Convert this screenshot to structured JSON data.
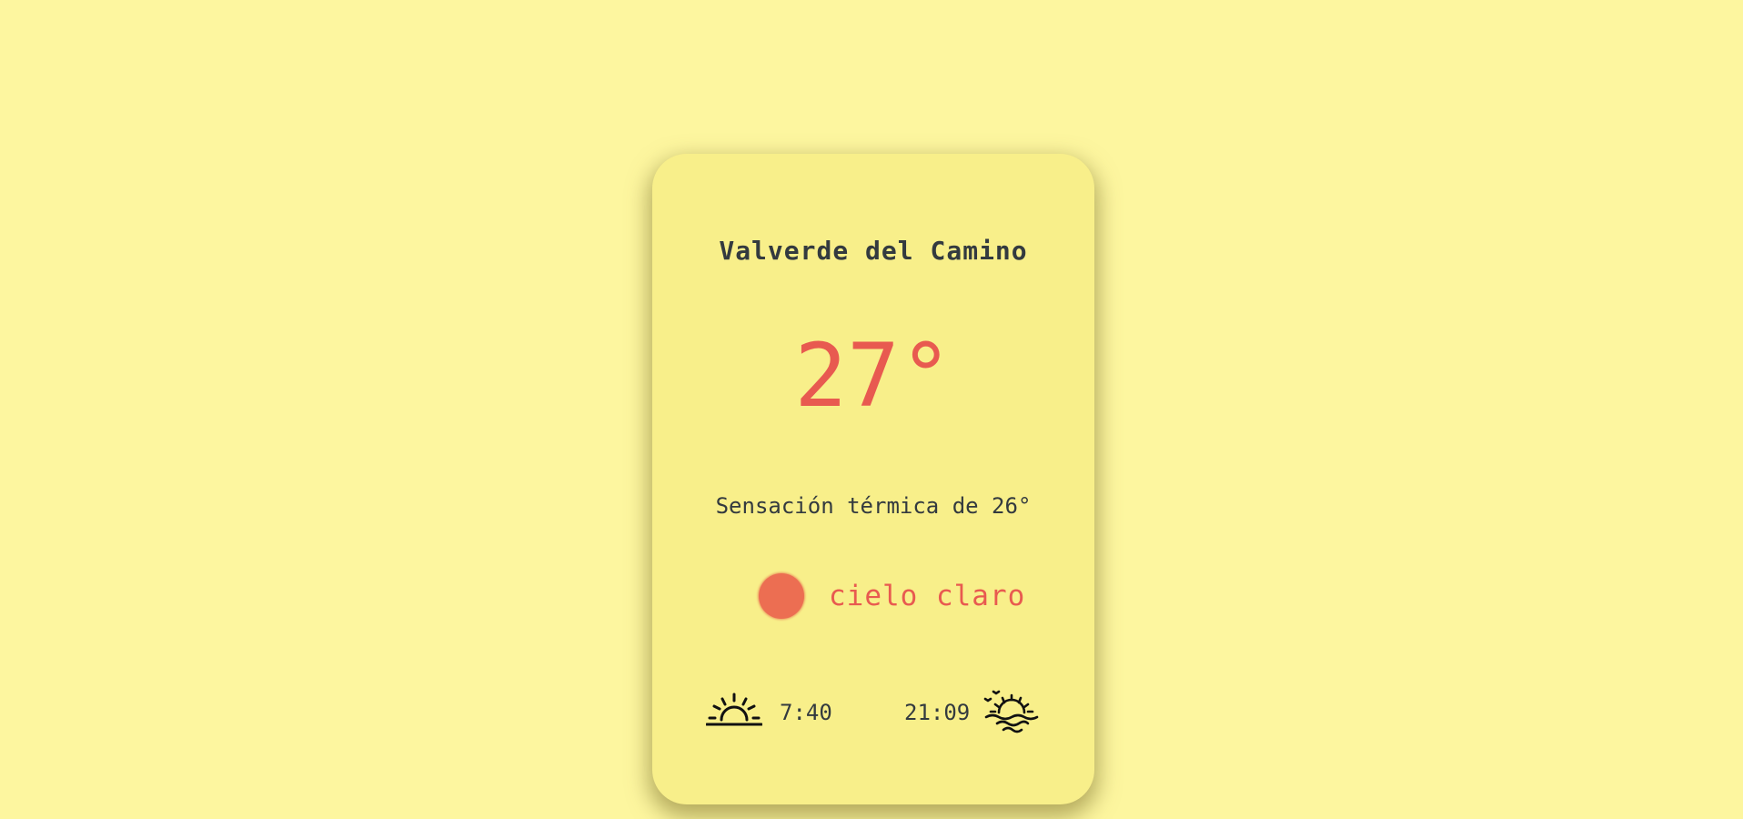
{
  "weather_card": {
    "city": "Valverde del Camino",
    "temperature": "27°",
    "feels_like": "Sensación térmica de 26°",
    "description": "cielo claro",
    "condition_icon": "sun-icon",
    "sunrise": {
      "time": "7:40",
      "icon": "sunrise-icon"
    },
    "sunset": {
      "time": "21:09",
      "icon": "sunset-icon"
    }
  },
  "colors": {
    "background": "#fdf69f",
    "card": "#f8ef8a",
    "accent": "#e85a50",
    "sun": "#ec6e52",
    "text": "#333a3f"
  }
}
